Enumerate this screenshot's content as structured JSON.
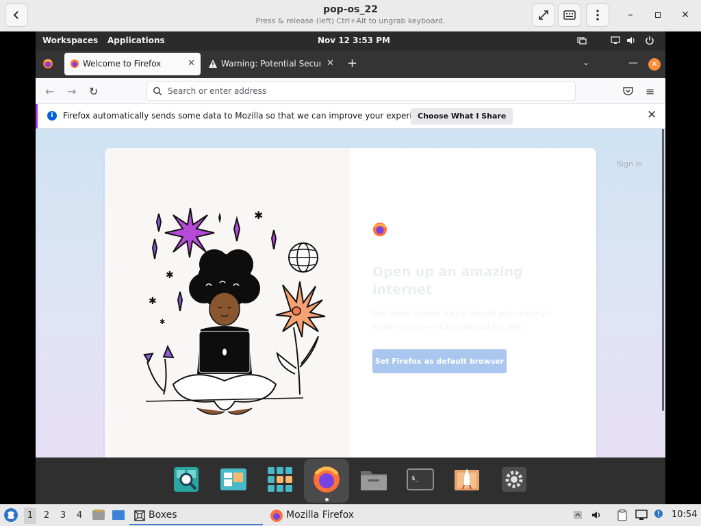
{
  "boxes": {
    "title": "pop-os_22",
    "subtitle": "Press & release (left) Ctrl+Alt to ungrab keyboard."
  },
  "pop_topbar": {
    "workspaces": "Workspaces",
    "applications": "Applications",
    "clock": "Nov 12   3:53 PM"
  },
  "firefox": {
    "tabs": [
      {
        "label": "Welcome to Firefox",
        "active": true
      },
      {
        "label": "Warning: Potential Security Risk Ahead",
        "active": false
      }
    ],
    "urlbar_placeholder": "Search or enter address",
    "notification": {
      "text": "Firefox automatically sends some data to Mozilla so that we can improve your experience.",
      "button": "Choose What I Share"
    },
    "page": {
      "sign_in": "Sign in",
      "heading": "Open up an amazing internet",
      "subtext": "Our latest version is built around you, making it easier than ever to hop around the web.",
      "cta": "Set Firefox as default browser"
    }
  },
  "dock": {
    "items": [
      "search-launcher",
      "files-manager",
      "app-grid",
      "firefox",
      "file-manager",
      "terminal",
      "pop-shop",
      "settings"
    ]
  },
  "taskbar": {
    "workspaces": [
      "1",
      "2",
      "3",
      "4"
    ],
    "tasks": [
      {
        "label": "Boxes",
        "active": true
      },
      {
        "label": "Mozilla Firefox",
        "active": false
      }
    ],
    "clock": "10:54"
  },
  "colors": {
    "accent_orange": "#fb8c3a",
    "notification_stripe": "#b833e1",
    "cta_blue": "#a9c6ee"
  }
}
